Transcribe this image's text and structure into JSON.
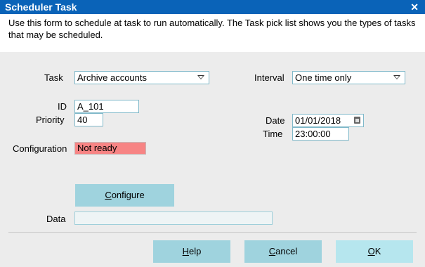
{
  "window": {
    "title": "Scheduler Task",
    "close_glyph": "✕"
  },
  "description": "Use this form to schedule at task to run automatically. The Task pick list shows you the types of tasks that may be scheduled.",
  "form": {
    "task": {
      "label": "Task",
      "value": "Archive accounts"
    },
    "interval": {
      "label": "Interval",
      "value": "One time only"
    },
    "id": {
      "label": "ID",
      "value": "A_101"
    },
    "priority": {
      "label": "Priority",
      "value": "40"
    },
    "date": {
      "label": "Date",
      "value": "01/01/2018",
      "icon": "calendar-icon"
    },
    "time": {
      "label": "Time",
      "value": "23:00:00"
    },
    "configuration": {
      "label": "Configuration",
      "status": "Not ready",
      "status_color": "#f78484"
    },
    "configure_button": {
      "mnemonic": "C",
      "rest": "onfigure"
    },
    "data": {
      "label": "Data",
      "value": ""
    }
  },
  "buttons": {
    "help": {
      "mnemonic": "H",
      "rest": "elp"
    },
    "cancel": {
      "mnemonic": "C",
      "rest": "ancel"
    },
    "ok": {
      "mnemonic": "O",
      "rest": "K"
    }
  },
  "colors": {
    "titlebar": "#0a63b8",
    "button": "#9fd3de",
    "field_border": "#7fb8c9"
  }
}
